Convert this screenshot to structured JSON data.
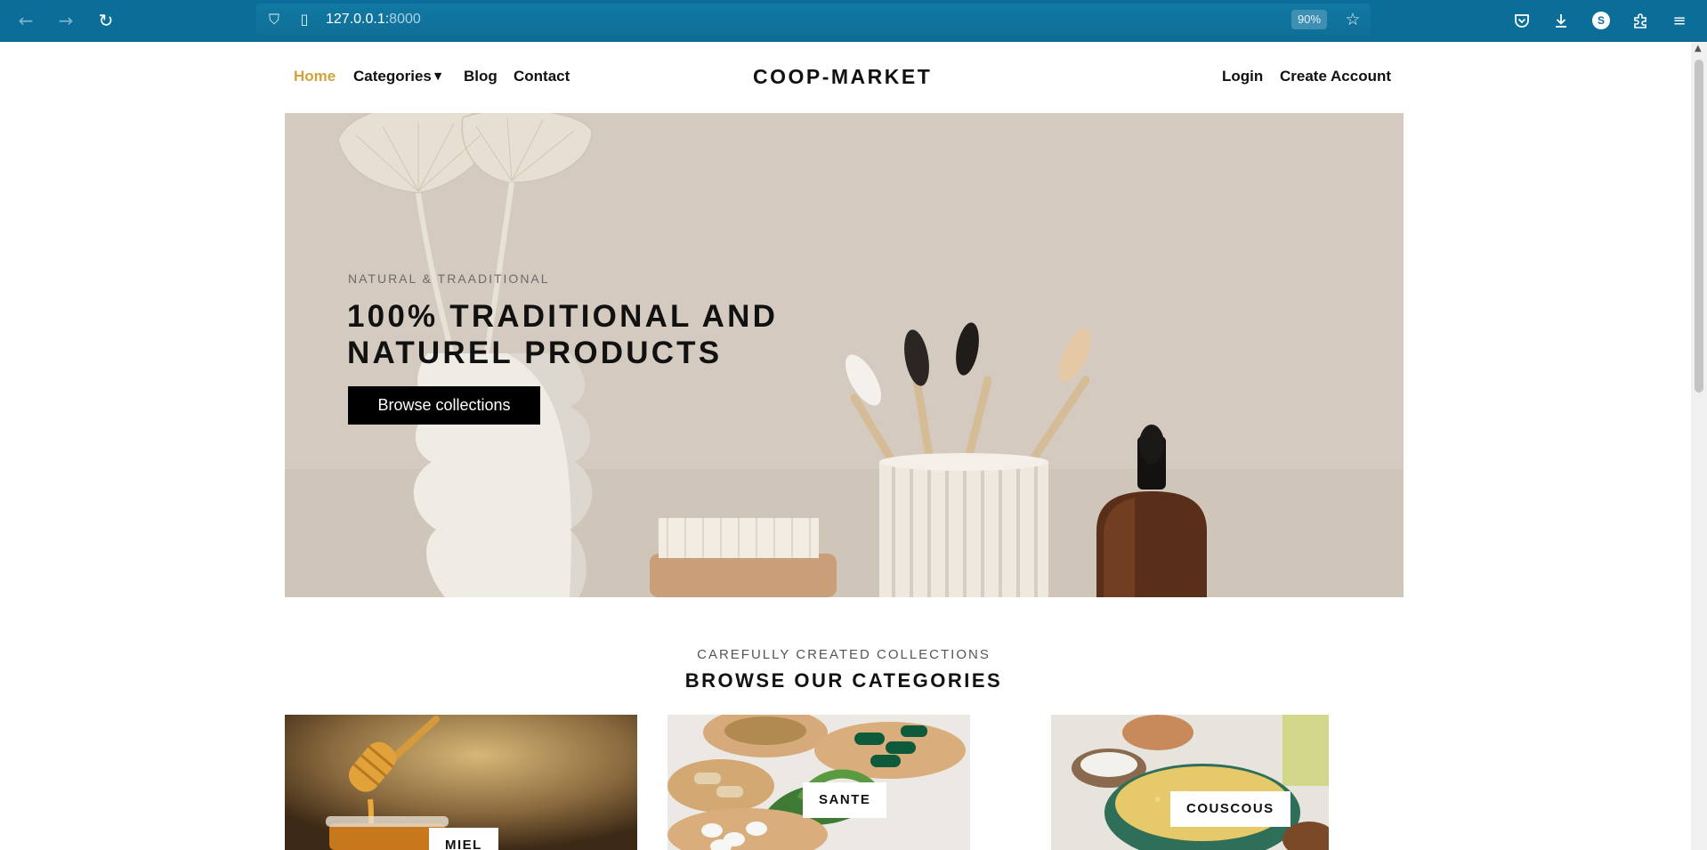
{
  "browser": {
    "url_host": "127.0.0.1:",
    "url_port": "8000",
    "zoom": "90%",
    "profile_initial": "S"
  },
  "nav": {
    "home": "Home",
    "categories": "Categories",
    "blog": "Blog",
    "contact": "Contact",
    "brand": "COOP-MARKET",
    "login": "Login",
    "create_account": "Create Account"
  },
  "hero": {
    "subtitle": "NATURAL & TRAADITIONAL",
    "title_line1": "100% TRADITIONAL AND",
    "title_line2": "NATUREL PRODUCTS",
    "button": "Browse collections"
  },
  "categories": {
    "kicker": "CAREFULLY CREATED COLLECTIONS",
    "title": "BROWSE OUR CATEGORIES",
    "items": [
      {
        "label": "MIEL"
      },
      {
        "label": "SANTE"
      },
      {
        "label": "COUSCOUS"
      }
    ]
  },
  "colors": {
    "browser_bar": "#0b6e99",
    "active_nav": "#d4a23c",
    "hero_bg": "#d3c9be",
    "button_bg": "#000000"
  }
}
